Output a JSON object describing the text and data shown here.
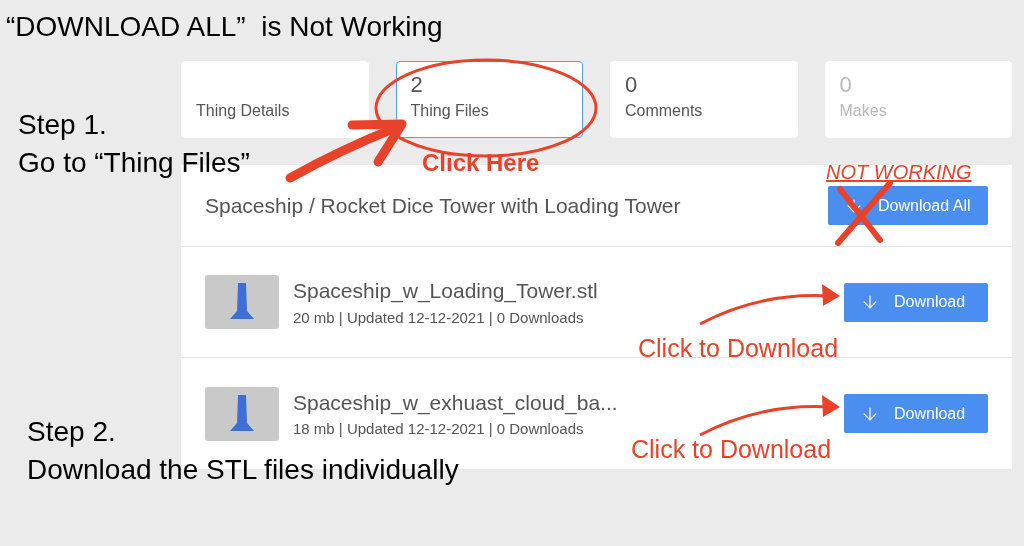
{
  "heading": "“DOWNLOAD ALL”  is Not Working",
  "tabs": [
    {
      "label": "Thing Details",
      "selected": false,
      "disabled": false
    },
    {
      "count": "2",
      "label": "Thing Files",
      "selected": true,
      "disabled": false
    },
    {
      "count": "0",
      "label": "Comments",
      "selected": false,
      "disabled": false
    },
    {
      "count": "0",
      "label": "Makes",
      "selected": false,
      "disabled": true
    }
  ],
  "panel": {
    "title": "Spaceship / Rocket Dice Tower with Loading Tower",
    "download_all": "Download All",
    "files": [
      {
        "name": "Spaceship_w_Loading_Tower.stl",
        "meta": "20 mb | Updated 12-12-2021 | 0 Downloads",
        "button": "Download"
      },
      {
        "name": "Spaceship_w_exhuast_cloud_ba...",
        "meta": "18 mb | Updated 12-12-2021 | 0 Downloads",
        "button": "Download"
      }
    ]
  },
  "annotations": {
    "step_1": [
      "Step 1.",
      "Go to “Thing Files”"
    ],
    "click_here": "Click Here",
    "not_working": "NOT WORKING",
    "click_to_download": [
      "Click to Download",
      "Click to Download"
    ],
    "step_2": [
      "Step 2.",
      "Download the STL files individually"
    ]
  }
}
